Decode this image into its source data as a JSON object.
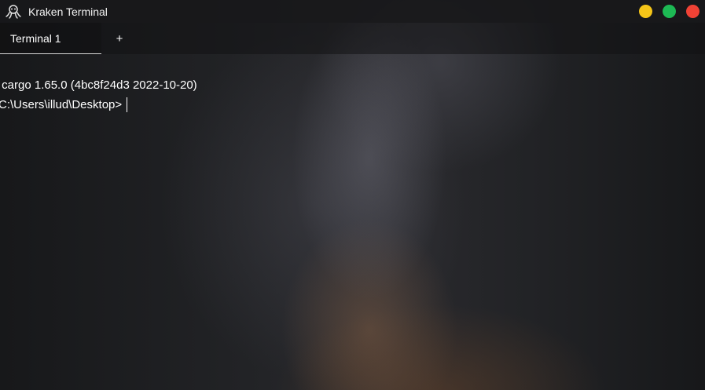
{
  "window": {
    "title": "Kraken Terminal",
    "icon": "kraken-octopus-icon",
    "controls": [
      {
        "name": "minimize",
        "color": "#f5c518"
      },
      {
        "name": "maximize",
        "color": "#1db954"
      },
      {
        "name": "close",
        "color": "#f04235"
      }
    ]
  },
  "tabs": [
    {
      "label": "Terminal 1",
      "active": true
    }
  ],
  "new_tab_label": "+",
  "terminal": {
    "output": [
      " cargo 1.65.0 (4bc8f24d3 2022-10-20)"
    ],
    "prompt": "C:\\Users\\illud\\Desktop>",
    "input": ""
  }
}
